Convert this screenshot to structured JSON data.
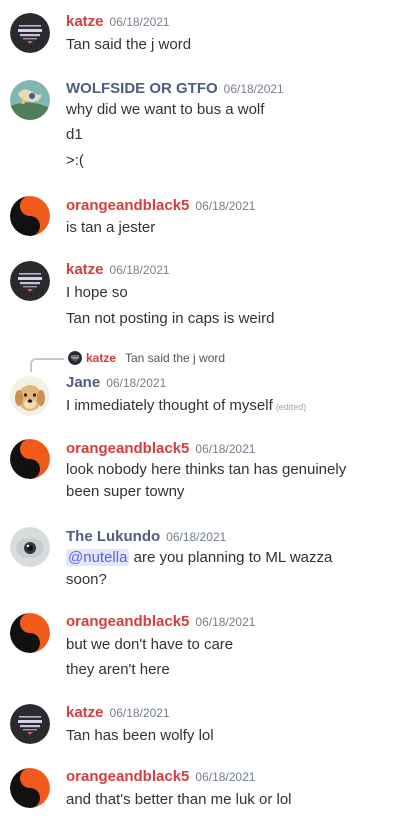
{
  "colors": {
    "red_author": "#d83c3e",
    "slate_author": "#4f5d7e",
    "timestamp": "#747f8d",
    "text": "#2e3338",
    "mention_bg": "#e3e7f8",
    "mention_fg": "#5865f2"
  },
  "messages": [
    {
      "author": "katze",
      "author_color": "#d83c3e",
      "avatar_icon": "katze-avatar-icon",
      "timestamp": "06/18/2021",
      "lines": [
        "Tan said the j word"
      ]
    },
    {
      "author": "WOLFSIDE OR GTFO",
      "author_color": "#4f5d7e",
      "avatar_icon": "wolfside-avatar-icon",
      "timestamp": "06/18/2021",
      "lines": [
        "why did we want to bus a wolf",
        "d1",
        ">:("
      ]
    },
    {
      "author": "orangeandblack5",
      "author_color": "#d83c3e",
      "avatar_icon": "yin-yang-avatar-icon",
      "timestamp": "06/18/2021",
      "lines": [
        "is tan a jester"
      ]
    },
    {
      "author": "katze",
      "author_color": "#d83c3e",
      "avatar_icon": "katze-avatar-icon",
      "timestamp": "06/18/2021",
      "lines": [
        "I hope so",
        "Tan not posting in caps is weird"
      ]
    },
    {
      "reply": {
        "author": "katze",
        "text": "Tan said the j word"
      },
      "author": "Jane",
      "author_color": "#4f5d7e",
      "avatar_icon": "dog-avatar-icon",
      "timestamp": "06/18/2021",
      "lines": [
        "I immediately thought of myself"
      ],
      "edited": "(edited)"
    },
    {
      "author": "orangeandblack5",
      "author_color": "#d83c3e",
      "avatar_icon": "yin-yang-avatar-icon",
      "timestamp": "06/18/2021",
      "lines": [
        "look nobody here thinks tan has genuinely been super towny"
      ]
    },
    {
      "author": "The Lukundo",
      "author_color": "#4f5d7e",
      "avatar_icon": "eye-avatar-icon",
      "timestamp": "06/18/2021",
      "mention": "@nutella",
      "lines": [
        " are you planning to ML wazza soon?"
      ]
    },
    {
      "author": "orangeandblack5",
      "author_color": "#d83c3e",
      "avatar_icon": "yin-yang-avatar-icon",
      "timestamp": "06/18/2021",
      "lines": [
        "but we don't have to care",
        "they aren't here"
      ]
    },
    {
      "author": "katze",
      "author_color": "#d83c3e",
      "avatar_icon": "katze-avatar-icon",
      "timestamp": "06/18/2021",
      "lines": [
        "Tan has been wolfy lol"
      ]
    },
    {
      "author": "orangeandblack5",
      "author_color": "#d83c3e",
      "avatar_icon": "yin-yang-avatar-icon",
      "timestamp": "06/18/2021",
      "lines": [
        "and that's better than me luk or lol"
      ]
    }
  ]
}
